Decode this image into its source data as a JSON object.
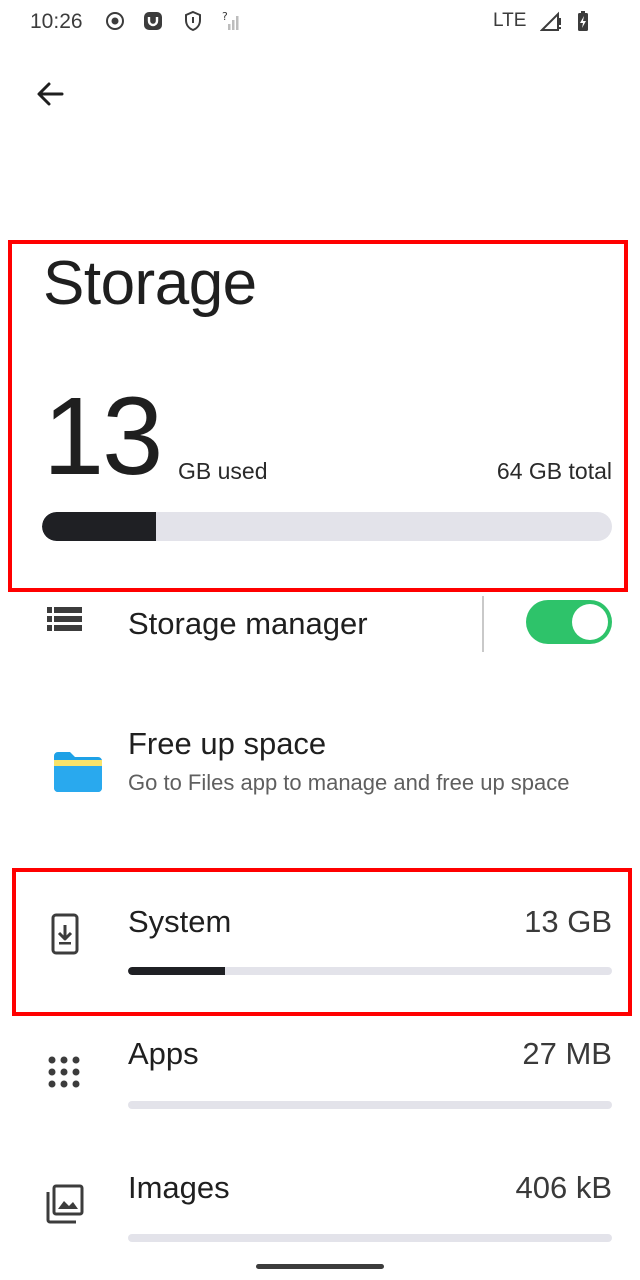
{
  "status_bar": {
    "time": "10:26",
    "network": "LTE"
  },
  "header": {
    "title": "Storage",
    "used_value": "13",
    "used_unit": "GB used",
    "total": "64 GB total",
    "used_fraction": 0.2
  },
  "list": {
    "storage_manager": {
      "label": "Storage manager",
      "enabled": true
    },
    "free_up_space": {
      "title": "Free up space",
      "subtitle": "Go to Files app to manage and free up space"
    },
    "categories": [
      {
        "name": "System",
        "size": "13 GB",
        "fraction": 0.2
      },
      {
        "name": "Apps",
        "size": "27 MB",
        "fraction": 0.0
      },
      {
        "name": "Images",
        "size": "406 kB",
        "fraction": 0.0
      }
    ]
  },
  "colors": {
    "accent_toggle": "#2ec36a",
    "bar_fill": "#1f2024",
    "bar_track": "#e3e3ea",
    "highlight": "#ff0000"
  }
}
